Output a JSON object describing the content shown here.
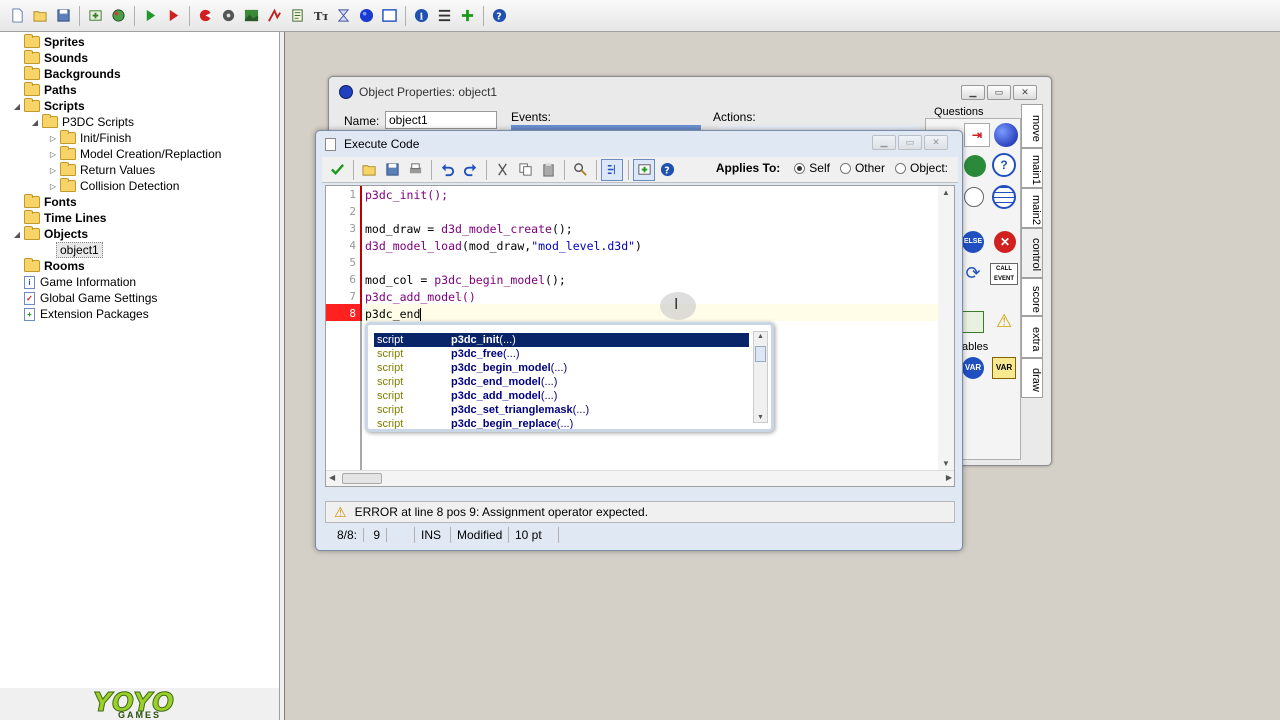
{
  "toolbar": {
    "icons": [
      "new-file-icon",
      "open-folder-icon",
      "save-icon",
      "publish-icon",
      "globe-icon",
      "run-icon",
      "debug-run-icon",
      "create-sprite-icon",
      "create-sound-icon",
      "create-background-icon",
      "create-path-icon",
      "create-script-icon",
      "create-font-icon",
      "create-timeline-icon",
      "create-object-icon",
      "create-room-icon",
      "game-info-icon",
      "game-settings-icon",
      "extension-icon",
      "help-icon"
    ]
  },
  "tree": {
    "items": [
      {
        "label": "Sprites",
        "bold": true
      },
      {
        "label": "Sounds",
        "bold": true
      },
      {
        "label": "Backgrounds",
        "bold": true
      },
      {
        "label": "Paths",
        "bold": true
      },
      {
        "label": "Scripts",
        "bold": true
      },
      {
        "label": "P3DC Scripts",
        "bold": false
      },
      {
        "label": "Init/Finish",
        "bold": false
      },
      {
        "label": "Model Creation/Replaction",
        "bold": false
      },
      {
        "label": "Return Values",
        "bold": false
      },
      {
        "label": "Collision Detection",
        "bold": false
      },
      {
        "label": "Fonts",
        "bold": true
      },
      {
        "label": "Time Lines",
        "bold": true
      },
      {
        "label": "Objects",
        "bold": true
      },
      {
        "label": "object1",
        "bold": false
      },
      {
        "label": "Rooms",
        "bold": true
      },
      {
        "label": "Game Information",
        "bold": false
      },
      {
        "label": "Global Game Settings",
        "bold": false
      },
      {
        "label": "Extension Packages",
        "bold": false
      }
    ]
  },
  "logo": {
    "text": "YOYO",
    "sub": "GAMES"
  },
  "object_window": {
    "title": "Object Properties: object1",
    "name_label": "Name:",
    "name_value": "object1",
    "events_label": "Events:",
    "actions_label": "Actions:",
    "questions_label": "Questions",
    "ables_label": "ables",
    "tabs": [
      "move",
      "main1",
      "main2",
      "control",
      "score",
      "extra",
      "draw"
    ],
    "else_label": "ELSE",
    "call_event_label": "CALL EVENT",
    "var_label": "VAR"
  },
  "code_window": {
    "title": "Execute Code",
    "applies_to_label": "Applies To:",
    "applies_options": [
      "Self",
      "Other",
      "Object:"
    ],
    "line_numbers": [
      "1",
      "2",
      "3",
      "4",
      "5",
      "6",
      "7",
      "8"
    ],
    "lines": [
      "p3dc_init();",
      "",
      "mod_draw = d3d_model_create();",
      "d3d_model_load(mod_draw,\"mod_level.d3d\")",
      "",
      "mod_col = p3dc_begin_model();",
      "p3dc_add_model()",
      "p3dc_end"
    ],
    "error": "ERROR at line 8 pos 9: Assignment operator expected.",
    "status": {
      "position": "8/8:",
      "col": "9",
      "mode": "INS",
      "modified": "Modified",
      "font": "10 pt"
    }
  },
  "autocomplete": [
    {
      "type": "script",
      "name": "p3dc_init",
      "args": " (...)"
    },
    {
      "type": "script",
      "name": "p3dc_free",
      "args": " (...)"
    },
    {
      "type": "script",
      "name": "p3dc_begin_model",
      "args": " (...)"
    },
    {
      "type": "script",
      "name": "p3dc_end_model",
      "args": " (...)"
    },
    {
      "type": "script",
      "name": "p3dc_add_model",
      "args": " (...)"
    },
    {
      "type": "script",
      "name": "p3dc_set_trianglemask",
      "args": " (...)"
    },
    {
      "type": "script",
      "name": "p3dc_begin_replace",
      "args": " (...)"
    }
  ]
}
